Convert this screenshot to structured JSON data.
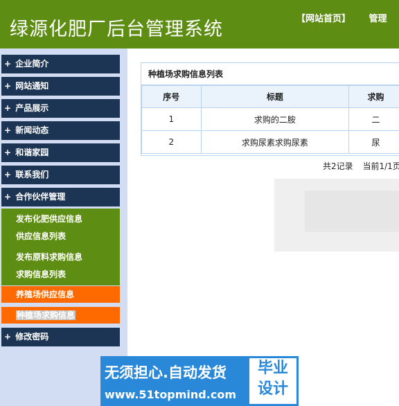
{
  "header": {
    "title": "绿源化肥厂后台管理系统",
    "nav": [
      "【网站首页】",
      "管理"
    ]
  },
  "sidebar": {
    "items": [
      {
        "label": "企业简介"
      },
      {
        "label": "网站通知"
      },
      {
        "label": "产品展示"
      },
      {
        "label": "新闻动态"
      },
      {
        "label": "和谐家园"
      },
      {
        "label": "联系我们"
      },
      {
        "label": "合作伙伴管理"
      }
    ],
    "partner_sub_1": [
      "发布化肥供应信息",
      "供应信息列表"
    ],
    "partner_sub_2": [
      "发布原料求购信息",
      "求购信息列表"
    ],
    "farm_supply": "养殖场供应信息",
    "plant_buy": "种植场求购信息",
    "change_password": "修改密码"
  },
  "panel": {
    "title": "种植场求购信息列表",
    "columns": [
      "序号",
      "标题",
      "求购"
    ],
    "rows": [
      {
        "no": "1",
        "title": "求购的二胺",
        "item": "二"
      },
      {
        "no": "2",
        "title": "求购尿素求购尿素",
        "item": "尿"
      }
    ]
  },
  "pager": {
    "total": "共2记录",
    "current": "当前1/1页"
  },
  "ad": {
    "slogan": "无须担心.自动发货",
    "url": "www.51topmind.com",
    "badge_line1": "毕业",
    "badge_line2": "设计"
  }
}
